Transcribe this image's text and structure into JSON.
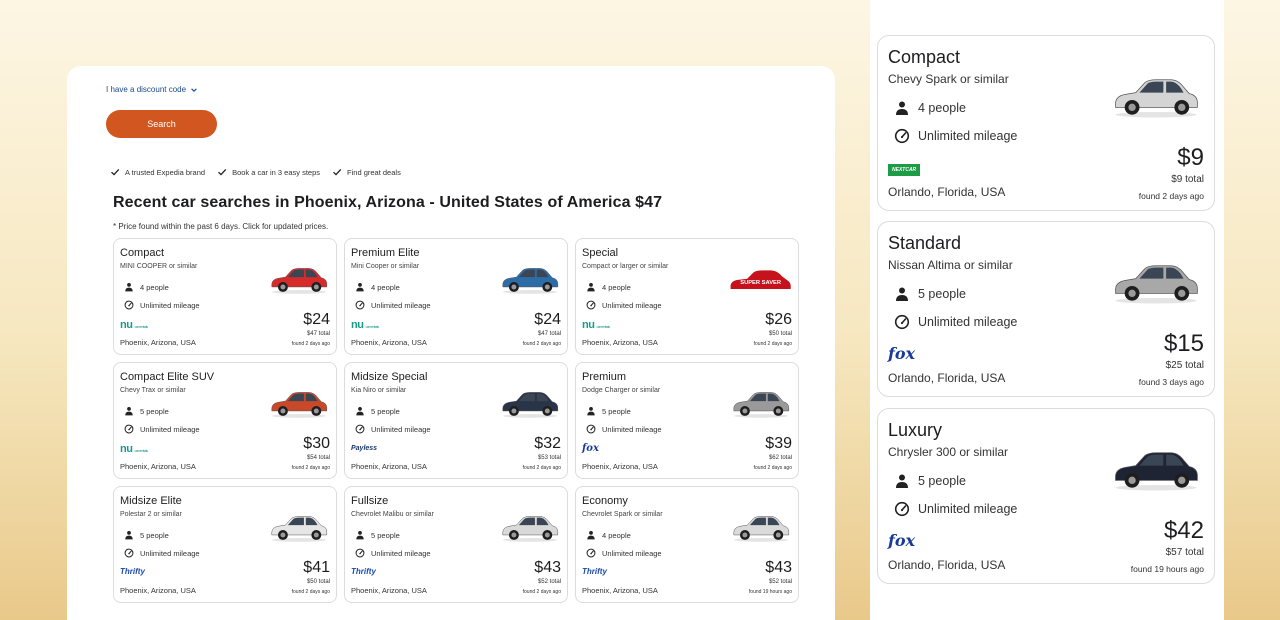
{
  "form": {
    "discount_label": "I have a discount code",
    "search_label": "Search"
  },
  "trust": [
    "A trusted Expedia brand",
    "Book a car in 3 easy steps",
    "Find great deals"
  ],
  "recent": {
    "heading": "Recent car searches in Phoenix, Arizona - United States of America $47",
    "note": "* Price found within the past 6 days. Click for updated prices."
  },
  "cards": [
    {
      "category": "Compact",
      "model": "MINI COOPER or similar",
      "people": "4 people",
      "mileage": "Unlimited mileage",
      "vendor": "nu",
      "location": "Phoenix, Arizona, USA",
      "price": "$24",
      "total": "$47 total",
      "found": "found 2 days ago",
      "car_color": "#d62b2b"
    },
    {
      "category": "Premium Elite",
      "model": "Mini Cooper or similar",
      "people": "4 people",
      "mileage": "Unlimited mileage",
      "vendor": "nu",
      "location": "Phoenix, Arizona, USA",
      "price": "$24",
      "total": "$47 total",
      "found": "found 2 days ago",
      "car_color": "#2e6ca8"
    },
    {
      "category": "Special",
      "model": "Compact or larger or similar",
      "people": "4 people",
      "mileage": "Unlimited mileage",
      "vendor": "nu",
      "location": "Phoenix, Arizona, USA",
      "price": "$26",
      "total": "$50 total",
      "found": "found 2 days ago",
      "car_color": "super-saver"
    },
    {
      "category": "Compact Elite SUV",
      "model": "Chevy Trax or similar",
      "people": "5 people",
      "mileage": "Unlimited mileage",
      "vendor": "nu",
      "location": "Phoenix, Arizona, USA",
      "price": "$30",
      "total": "$54 total",
      "found": "found 2 days ago",
      "car_color": "#c8482a"
    },
    {
      "category": "Midsize Special",
      "model": "Kia Niro or similar",
      "people": "5 people",
      "mileage": "Unlimited mileage",
      "vendor": "payless",
      "location": "Phoenix, Arizona, USA",
      "price": "$32",
      "total": "$53 total",
      "found": "found 2 days ago",
      "car_color": "#2a3448"
    },
    {
      "category": "Premium",
      "model": "Dodge Charger or similar",
      "people": "5 people",
      "mileage": "Unlimited mileage",
      "vendor": "fox",
      "location": "Phoenix, Arizona, USA",
      "price": "$39",
      "total": "$62 total",
      "found": "found 2 days ago",
      "car_color": "#9a9a9a"
    },
    {
      "category": "Midsize Elite",
      "model": "Polestar 2 or similar",
      "people": "5 people",
      "mileage": "Unlimited mileage",
      "vendor": "thrifty",
      "location": "Phoenix, Arizona, USA",
      "price": "$41",
      "total": "$50 total",
      "found": "found 2 days ago",
      "car_color": "#e6e6e6"
    },
    {
      "category": "Fullsize",
      "model": "Chevrolet Malibu or similar",
      "people": "5 people",
      "mileage": "Unlimited mileage",
      "vendor": "thrifty",
      "location": "Phoenix, Arizona, USA",
      "price": "$43",
      "total": "$52 total",
      "found": "found 2 days ago",
      "car_color": "#d9d9d9"
    },
    {
      "category": "Economy",
      "model": "Chevrolet Spark or similar",
      "people": "4 people",
      "mileage": "Unlimited mileage",
      "vendor": "thrifty",
      "location": "Phoenix, Arizona, USA",
      "price": "$43",
      "total": "$52 total",
      "found": "found 19 hours ago",
      "car_color": "#dadada"
    }
  ],
  "side_cards": [
    {
      "category": "Compact",
      "model": "Chevy Spark or similar",
      "people": "4 people",
      "mileage": "Unlimited mileage",
      "vendor": "nextcar",
      "location": "Orlando, Florida, USA",
      "price": "$9",
      "total": "$9 total",
      "found": "found 2 days ago",
      "car_color": "#d4d4d4"
    },
    {
      "category": "Standard",
      "model": "Nissan Altima or similar",
      "people": "5 people",
      "mileage": "Unlimited mileage",
      "vendor": "fox",
      "location": "Orlando, Florida, USA",
      "price": "$15",
      "total": "$25 total",
      "found": "found 3 days ago",
      "car_color": "#a8a8a8"
    },
    {
      "category": "Luxury",
      "model": "Chrysler 300 or similar",
      "people": "5 people",
      "mileage": "Unlimited mileage",
      "vendor": "fox",
      "location": "Orlando, Florida, USA",
      "price": "$42",
      "total": "$57 total",
      "found": "found 19 hours ago",
      "car_color": "#1e2433"
    }
  ],
  "vendor_labels": {
    "nu": "nu",
    "nu_small": "car rentals",
    "payless": "Payless",
    "fox": "fox",
    "thrifty": "Thrifty",
    "nextcar": "NEXTCAR"
  },
  "super_saver_label": "SUPER SAVER",
  "icons": {
    "people": "person-icon",
    "mileage": "speedometer-icon",
    "check": "checkmark-icon",
    "chevron": "chevron-down-icon"
  },
  "colors": {
    "accent": "#d2561f",
    "link": "#1a4a86",
    "border": "#dcdcdc"
  }
}
